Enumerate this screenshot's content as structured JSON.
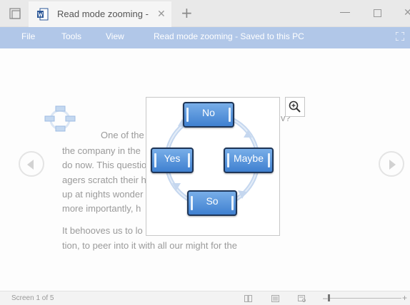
{
  "tab": {
    "title": "Read mode zooming -",
    "close_glyph": "✕",
    "new_glyph": "+"
  },
  "window": {
    "minimize_glyph": "—",
    "close_glyph": "✕"
  },
  "menu": {
    "file": "File",
    "tools": "Tools",
    "view": "View",
    "doc_status": "Read mode zooming  -  Saved to this PC"
  },
  "document": {
    "lines": [
      "One of the",
      "the company in the",
      "do now. This questio",
      "agers scratch their h",
      "up at nights wonder",
      "more importantly, h",
      "It behooves us to lo",
      "tion, to peer into it with all our might for the"
    ],
    "partial_right": "v?"
  },
  "diagram": {
    "nodes": [
      "No",
      "Yes",
      "Maybe",
      "So"
    ]
  },
  "status": {
    "screen_count": "Screen 1 of 5",
    "zoom_minus": "–",
    "zoom_plus": "+",
    "zoom_level_fraction": 0.0
  },
  "icons": {
    "tab_toggle": "tab-toggle-icon",
    "word": "word-app-icon",
    "fit": "fit-screen-icon",
    "zoom": "magnifier-plus-icon",
    "decorative_diagram": "smartart-thumbnail-icon",
    "nav_prev": "previous-screen-icon",
    "nav_next": "next-screen-icon",
    "read_mode": "read-mode-icon",
    "print_layout": "print-layout-icon",
    "web_layout": "web-layout-icon"
  },
  "colors": {
    "menu_bar": "#b1c7e8",
    "node_fill": "#4f8fd8",
    "node_border": "#1e3557",
    "cycle_arrow": "#c5d7ef"
  }
}
